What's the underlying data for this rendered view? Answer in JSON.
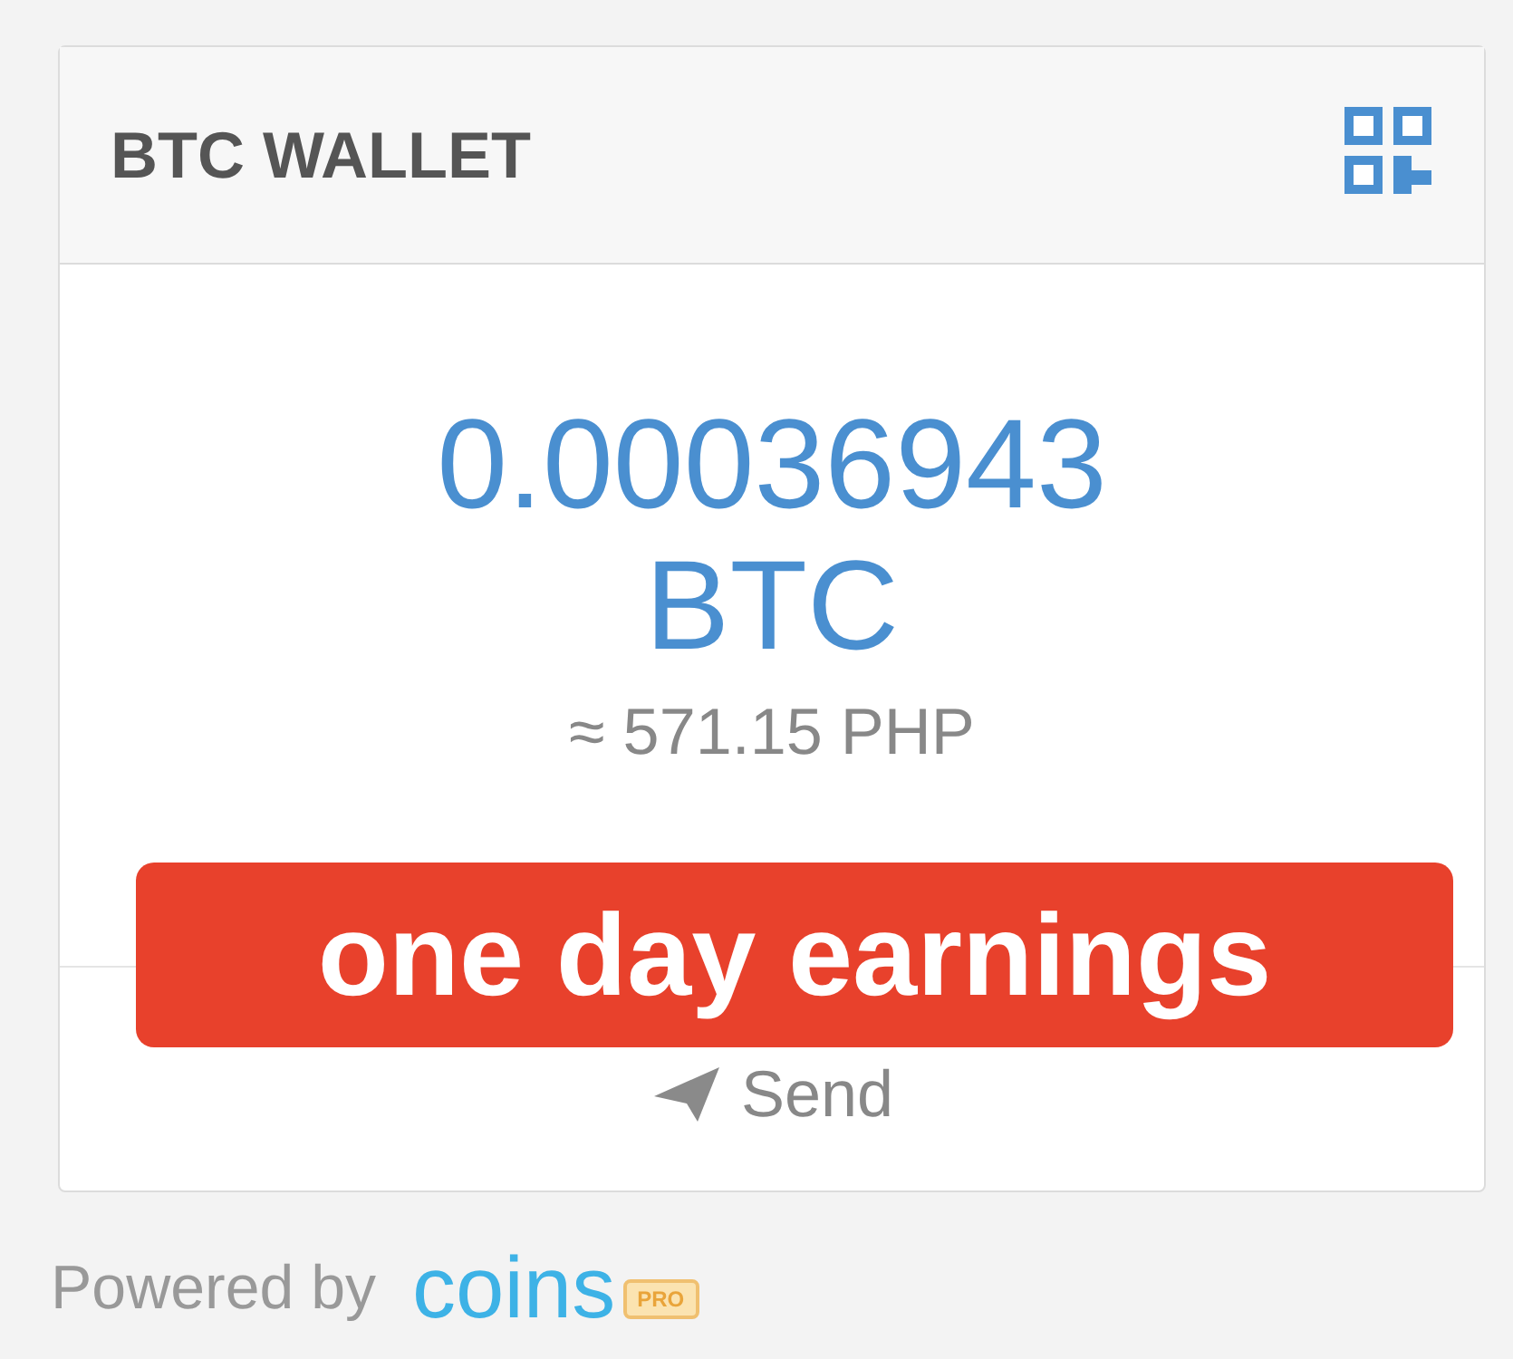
{
  "wallet": {
    "title": "BTC WALLET",
    "amount": "0.00036943",
    "currency": "BTC",
    "fiat": "≈ 571.15 PHP",
    "send": "Send"
  },
  "footer": {
    "powered": "Powered by",
    "brand": "coins",
    "badge": "PRO"
  },
  "caption": "one day earnings"
}
